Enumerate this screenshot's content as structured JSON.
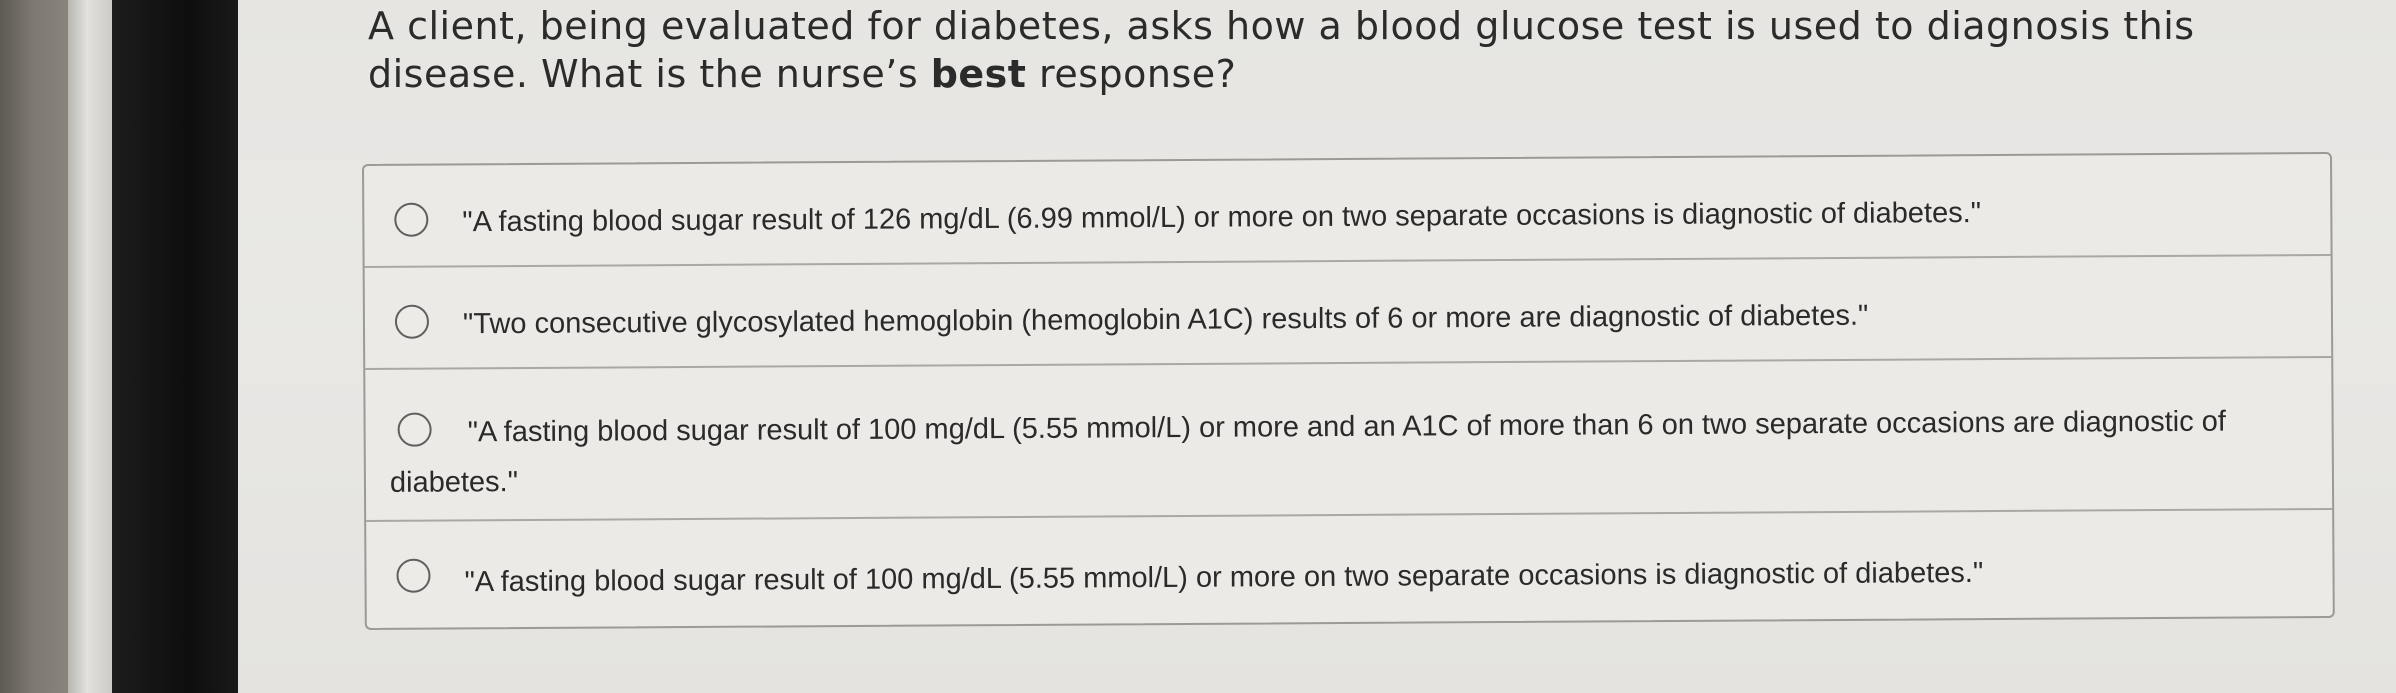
{
  "question": {
    "text_before": "A client, being evaluated for diabetes, asks how a blood glucose test is used to diagnosis this disease. What is the nurse’s ",
    "emphasis": "best",
    "text_after": " response?"
  },
  "options": [
    {
      "text": "\"A fasting blood sugar result of 126 mg/dL (6.99 mmol/L) or more on two separate occasions is diagnostic of diabetes.\"",
      "selected": false
    },
    {
      "text": "\"Two consecutive glycosylated hemoglobin (hemoglobin A1C) results of 6 or more are diagnostic of diabetes.\"",
      "selected": false
    },
    {
      "text": "\"A fasting blood sugar result of 100 mg/dL (5.55 mmol/L) or more and an A1C of more than 6 on two separate occasions are diagnostic of diabetes.\"",
      "selected": false
    },
    {
      "text": "\"A fasting blood sugar result of 100 mg/dL (5.55 mmol/L) or more on two separate occasions is diagnostic of diabetes.\"",
      "selected": false
    }
  ]
}
